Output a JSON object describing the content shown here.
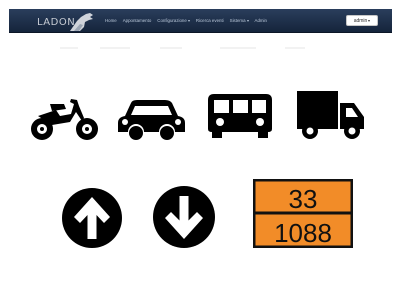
{
  "navbar": {
    "brand": "LADON",
    "items": [
      {
        "label": "Home",
        "dropdown": false
      },
      {
        "label": "Appontamento",
        "dropdown": false
      },
      {
        "label": "Configurazione",
        "dropdown": true
      },
      {
        "label": "Ricerca eventi",
        "dropdown": false
      },
      {
        "label": "Sistema",
        "dropdown": true
      },
      {
        "label": "Admin",
        "dropdown": false
      }
    ],
    "user": "admin"
  },
  "icons": [
    "motorcycle-icon",
    "car-icon",
    "bus-icon",
    "truck-icon",
    "arrow-up-circle-icon",
    "arrow-down-circle-icon"
  ],
  "hazard_plate": {
    "hazard_id": "33",
    "un_number": "1088",
    "background": "#f28c28",
    "border": "#111111"
  },
  "colors": {
    "navbar": "#1f314d",
    "icon": "#000000"
  }
}
